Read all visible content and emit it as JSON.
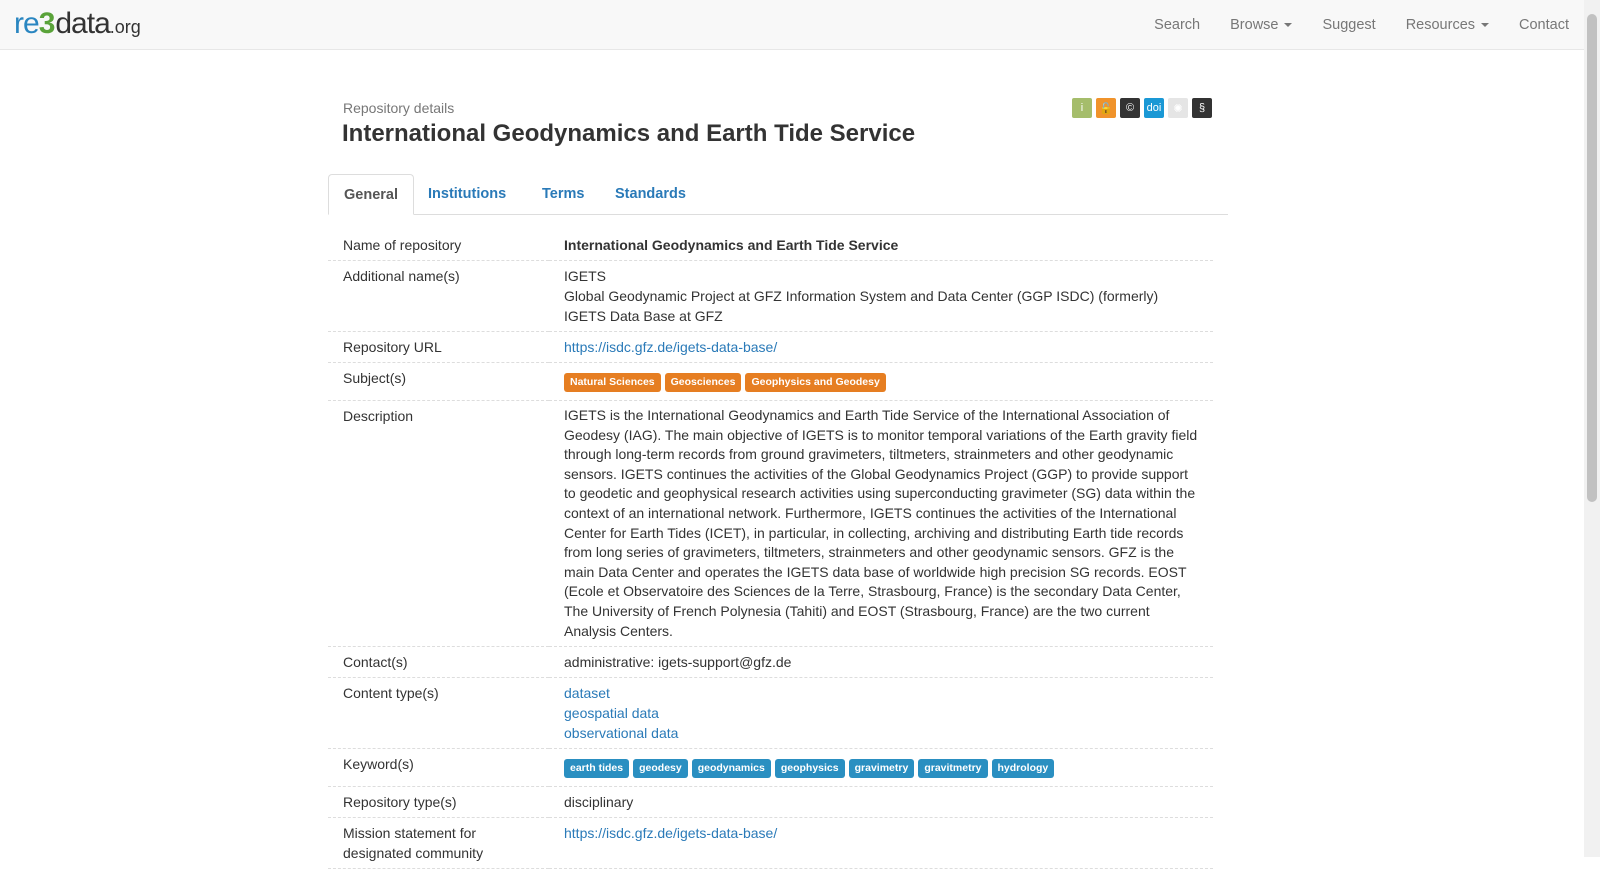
{
  "brand": {
    "re": "re",
    "three": "3",
    "data": "data",
    "org": ".org"
  },
  "nav": {
    "search": "Search",
    "browse": "Browse",
    "suggest": "Suggest",
    "resources": "Resources",
    "contact": "Contact"
  },
  "header": {
    "subtitle": "Repository details",
    "title": "International Geodynamics and Earth Tide Service",
    "icons": [
      {
        "name": "info-icon",
        "glyph": "i",
        "color": "#a5bd6b"
      },
      {
        "name": "lock-open-icon",
        "glyph": "🔓",
        "color": "#f0932b"
      },
      {
        "name": "copyright-icon",
        "glyph": "©",
        "color": "#333333"
      },
      {
        "name": "doi-icon",
        "glyph": "doi",
        "color": "#1a98d5"
      },
      {
        "name": "certificate-icon",
        "glyph": "✺",
        "color": "#e5e5e5"
      },
      {
        "name": "policy-icon",
        "glyph": "§",
        "color": "#333333"
      }
    ]
  },
  "tabs": [
    "General",
    "Institutions",
    "Terms",
    "Standards"
  ],
  "details": {
    "name_label": "Name of repository",
    "name_value": "International Geodynamics and Earth Tide Service",
    "additional_label": "Additional name(s)",
    "additional_values": [
      "IGETS",
      "Global Geodynamic Project at GFZ Information System and Data Center (GGP ISDC) (formerly)",
      "IGETS Data Base at GFZ"
    ],
    "url_label": "Repository URL",
    "url_value": "https://isdc.gfz.de/igets-data-base/",
    "subjects_label": "Subject(s)",
    "subjects": [
      "Natural Sciences",
      "Geosciences",
      "Geophysics and Geodesy"
    ],
    "description_label": "Description",
    "description_value": "IGETS is the International Geodynamics and Earth Tide Service of the International Association of Geodesy (IAG). The main objective of IGETS is to monitor temporal variations of the Earth gravity field through long-term records from ground gravimeters, tiltmeters, strainmeters and other geodynamic sensors. IGETS continues the activities of the Global Geodynamics Project (GGP) to provide support to geodetic and geophysical research activities using superconducting gravimeter (SG) data within the context of an international network. Furthermore, IGETS continues the activities of the International Center for Earth Tides (ICET), in particular, in collecting, archiving and distributing Earth tide records from long series of gravimeters, tiltmeters, strainmeters and other geodynamic sensors. GFZ is the main Data Center and operates the IGETS data base of worldwide high precision SG records. EOST (Ecole et Observatoire des Sciences de la Terre, Strasbourg, France) is the secondary Data Center, The University of French Polynesia (Tahiti) and EOST (Strasbourg, France) are the two current Analysis Centers.",
    "contacts_label": "Contact(s)",
    "contacts_value": "administrative: igets-support@gfz.de",
    "content_types_label": "Content type(s)",
    "content_types": [
      "dataset",
      "geospatial data",
      "observational data"
    ],
    "keywords_label": "Keyword(s)",
    "keywords": [
      "earth tides",
      "geodesy",
      "geodynamics",
      "geophysics",
      "gravimetry",
      "gravitmetry",
      "hydrology"
    ],
    "repo_type_label": "Repository type(s)",
    "repo_type_value": "disciplinary",
    "mission_label": "Mission statement for designated community",
    "mission_value": "https://isdc.gfz.de/igets-data-base/"
  }
}
